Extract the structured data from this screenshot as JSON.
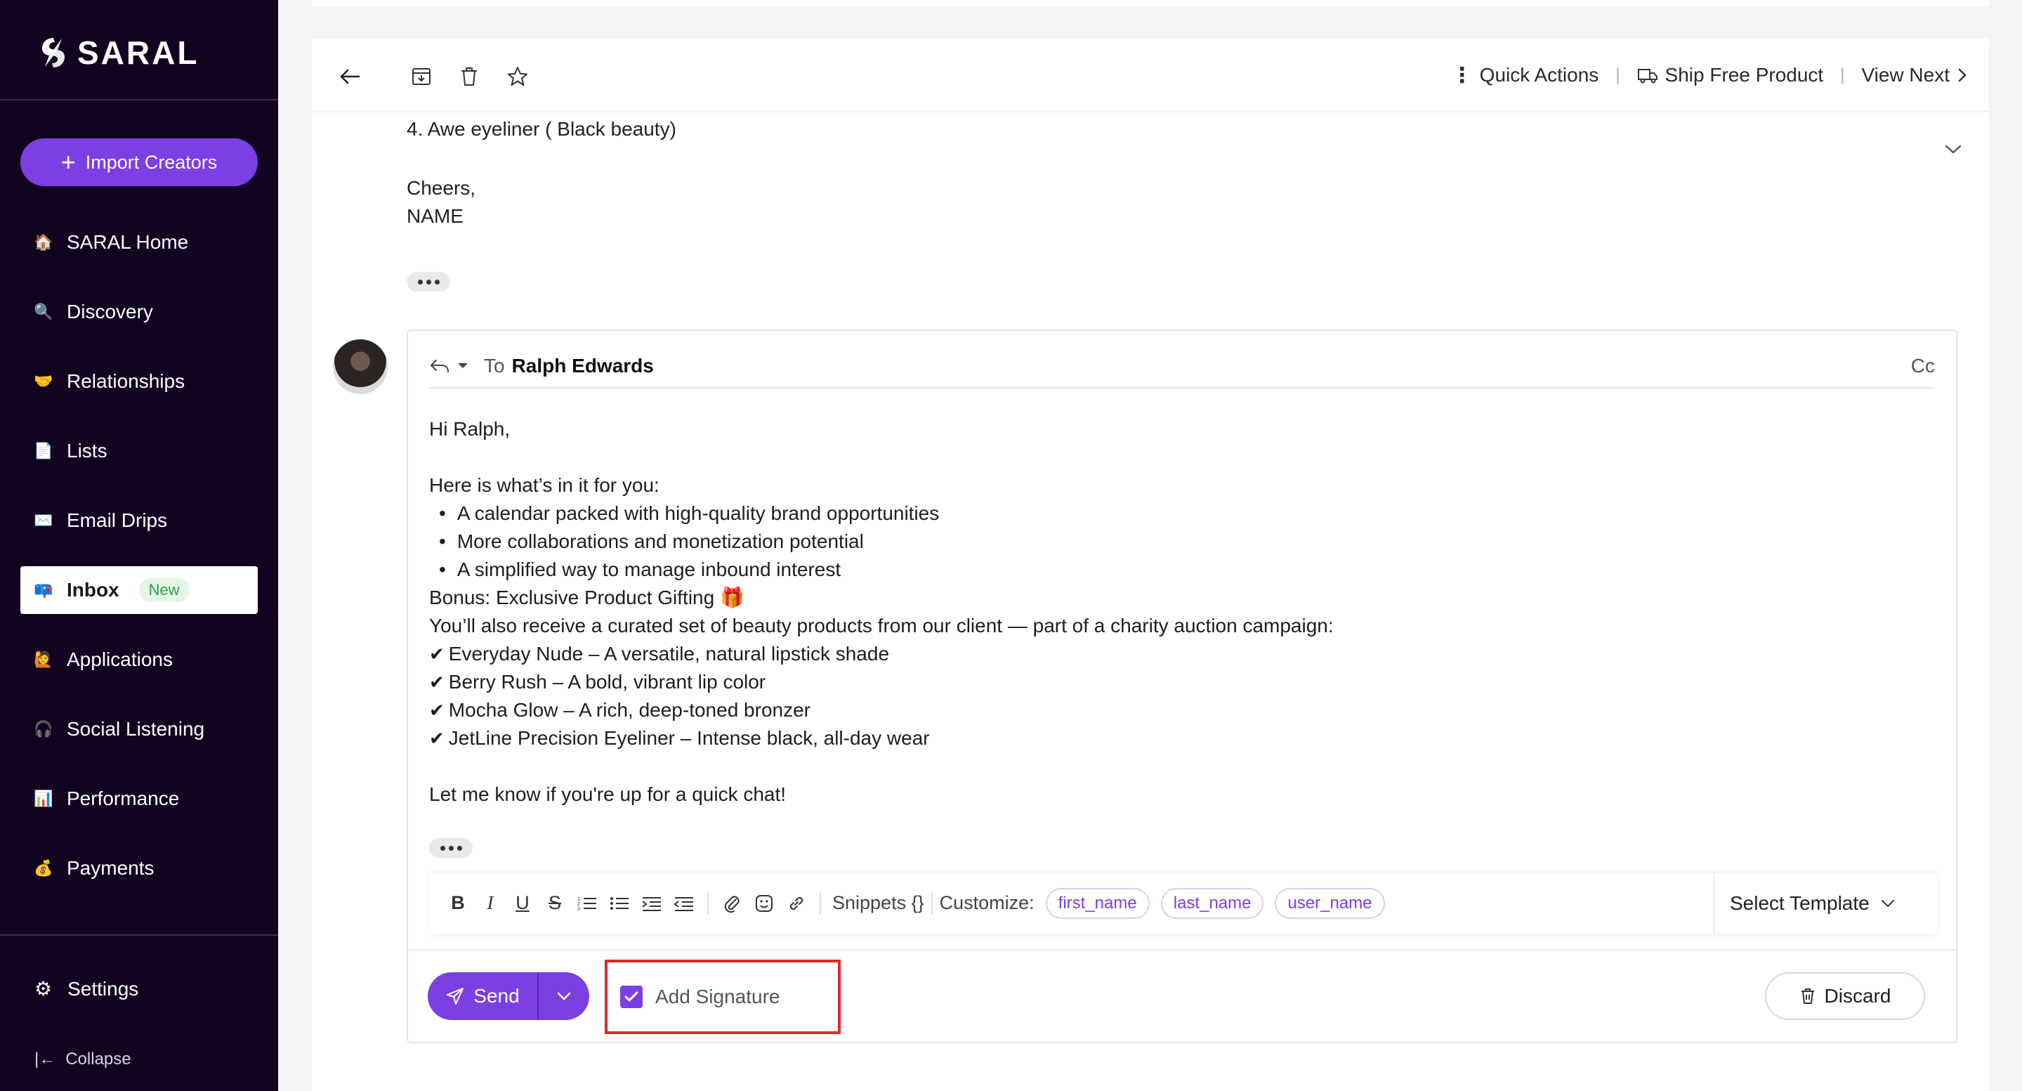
{
  "brand": {
    "name": "SARAL",
    "accent": "#7b3fe4",
    "sidebar_bg": "#120321"
  },
  "sidebar": {
    "import_button": "Import Creators",
    "items": [
      {
        "label": "SARAL Home",
        "icon": "house-icon"
      },
      {
        "label": "Discovery",
        "icon": "magnifier-icon"
      },
      {
        "label": "Relationships",
        "icon": "handshake-icon"
      },
      {
        "label": "Lists",
        "icon": "document-icon"
      },
      {
        "label": "Email Drips",
        "icon": "envelope-icon"
      },
      {
        "label": "Inbox",
        "icon": "mailbox-icon",
        "badge": "New",
        "active": true
      },
      {
        "label": "Applications",
        "icon": "person-raising-hand-icon"
      },
      {
        "label": "Social Listening",
        "icon": "listening-icon"
      },
      {
        "label": "Performance",
        "icon": "bar-chart-icon"
      },
      {
        "label": "Payments",
        "icon": "money-bag-icon"
      }
    ],
    "settings": "Settings",
    "collapse": "Collapse"
  },
  "toolbar": {
    "quick_actions": "Quick Actions",
    "ship_free_product": "Ship Free Product",
    "view_next": "View Next"
  },
  "previous_message": {
    "lines": [
      "4. Awe eyeliner ( Black beauty)",
      "",
      "Cheers,",
      "NAME"
    ]
  },
  "compose": {
    "to_label": "To",
    "recipient": "Ralph Edwards",
    "cc": "Cc",
    "body": {
      "greeting": "Hi Ralph,",
      "intro": "Here is what’s in it for you:",
      "bullets": [
        "A calendar packed with high-quality brand opportunities",
        "More collaborations and monetization potential",
        "A simplified way to manage inbound interest"
      ],
      "bonus": "Bonus: Exclusive Product Gifting 🎁",
      "products_intro": "You’ll also receive a curated set of beauty products from our client — part of a charity auction campaign:",
      "products": [
        "Everyday Nude – A versatile, natural lipstick shade",
        "Berry Rush – A bold, vibrant lip color",
        "Mocha Glow – A rich, deep-toned bronzer",
        "JetLine Precision Eyeliner – Intense black, all-day wear"
      ],
      "closing": "Let me know if you're up for a quick chat!"
    },
    "format_bar": {
      "snippets": "Snippets {}",
      "customize": "Customize:",
      "chips": [
        "first_name",
        "last_name",
        "user_name"
      ],
      "select_template": "Select Template"
    },
    "send": "Send",
    "add_signature": "Add Signature",
    "add_signature_checked": true,
    "discard": "Discard"
  }
}
